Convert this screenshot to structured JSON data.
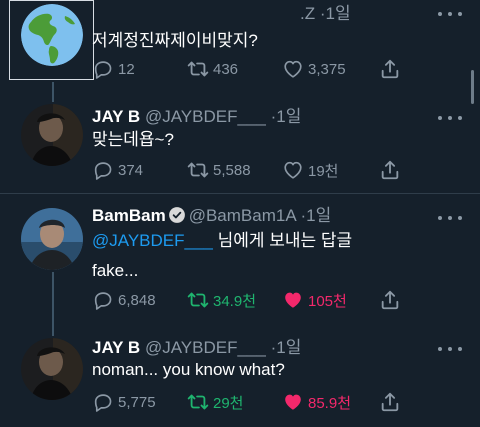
{
  "tweets": [
    {
      "handle_tail": ".Z",
      "time": "1일",
      "text": "저계정진짜제이비맞지?",
      "replies": "12",
      "retweets": "436",
      "likes": "3,375",
      "avatar_icon": "globe-avatar"
    },
    {
      "name": "JAY B",
      "handle": "@JAYBDEF___",
      "time": "1일",
      "text": "맞는데욥~?",
      "replies": "374",
      "retweets": "5,588",
      "likes": "19천"
    },
    {
      "name": "BamBam",
      "handle": "@BamBam1A",
      "time": "1일",
      "mention": "@JAYBDEF___",
      "reply_note": "님에게 보내는 답글",
      "text": "fake...",
      "replies": "6,848",
      "retweets": "34.9천",
      "likes": "105천"
    },
    {
      "name": "JAY B",
      "handle": "@JAYBDEF___",
      "time": "1일",
      "text": "noman... you know what?",
      "replies": "5,775",
      "retweets": "29천",
      "likes": "85.9천"
    }
  ],
  "colors": {
    "background": "#15202b",
    "muted": "#8b98a5",
    "link": "#1d9bf0",
    "retweet_active": "#1fb56f",
    "like_active": "#f3286b"
  },
  "icons": [
    "reply-icon",
    "retweet-icon",
    "like-icon",
    "share-icon",
    "more-icon",
    "verified-badge-icon"
  ]
}
